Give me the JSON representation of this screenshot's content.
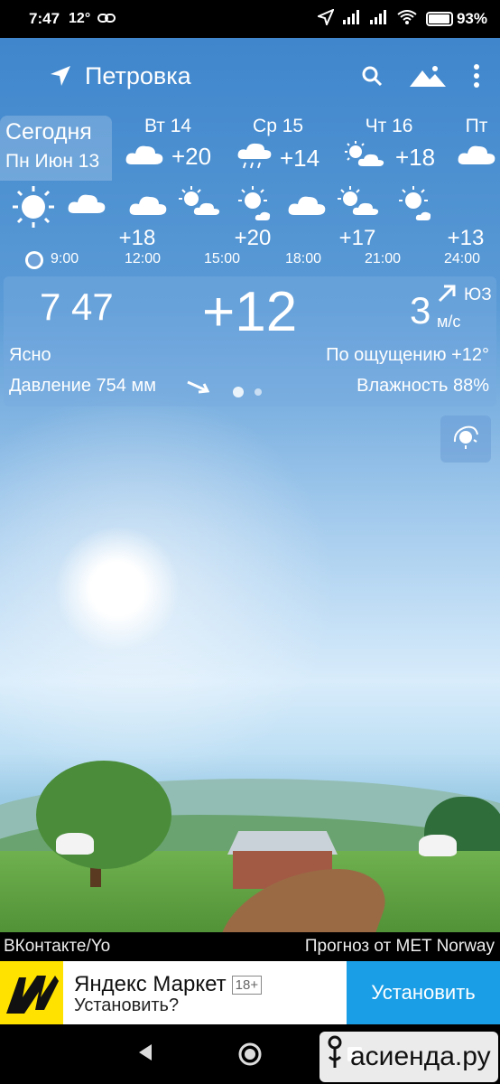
{
  "status_bar": {
    "time": "7:47",
    "temp_badge": "12°",
    "battery": "93%"
  },
  "header": {
    "location": "Петровка"
  },
  "days": [
    {
      "line1": "Сегодня",
      "line2": "Пн Июн 13"
    },
    {
      "name": "Вт 14",
      "temp": "+20",
      "icon": "cloud-icon"
    },
    {
      "name": "Ср 15",
      "temp": "+14",
      "icon": "rain-cloud-icon"
    },
    {
      "name": "Чт 16",
      "temp": "+18",
      "icon": "sun-cloud-icon"
    },
    {
      "name": "Пт",
      "icon": "cloud-icon"
    }
  ],
  "hourly": {
    "temps": [
      "+18",
      "+20",
      "+17",
      "+13"
    ],
    "times": [
      "9:00",
      "12:00",
      "15:00",
      "18:00",
      "21:00",
      "24:00"
    ]
  },
  "current": {
    "time": "7 47",
    "temp": "+12",
    "wind_speed": "3",
    "wind_unit": "м/с",
    "wind_dir": "ЮЗ",
    "condition": "Ясно",
    "feels_like": "По ощущению +12°",
    "pressure": "Давление 754 мм",
    "humidity": "Влажность 88%"
  },
  "credits": {
    "left": "ВКонтакте/Yo",
    "right": "Прогноз от MET Norway"
  },
  "ad": {
    "title": "Яндекс Маркет",
    "age": "18+",
    "subtitle": "Установить?",
    "button": "Установить"
  },
  "watermark": "асиенда.ру"
}
